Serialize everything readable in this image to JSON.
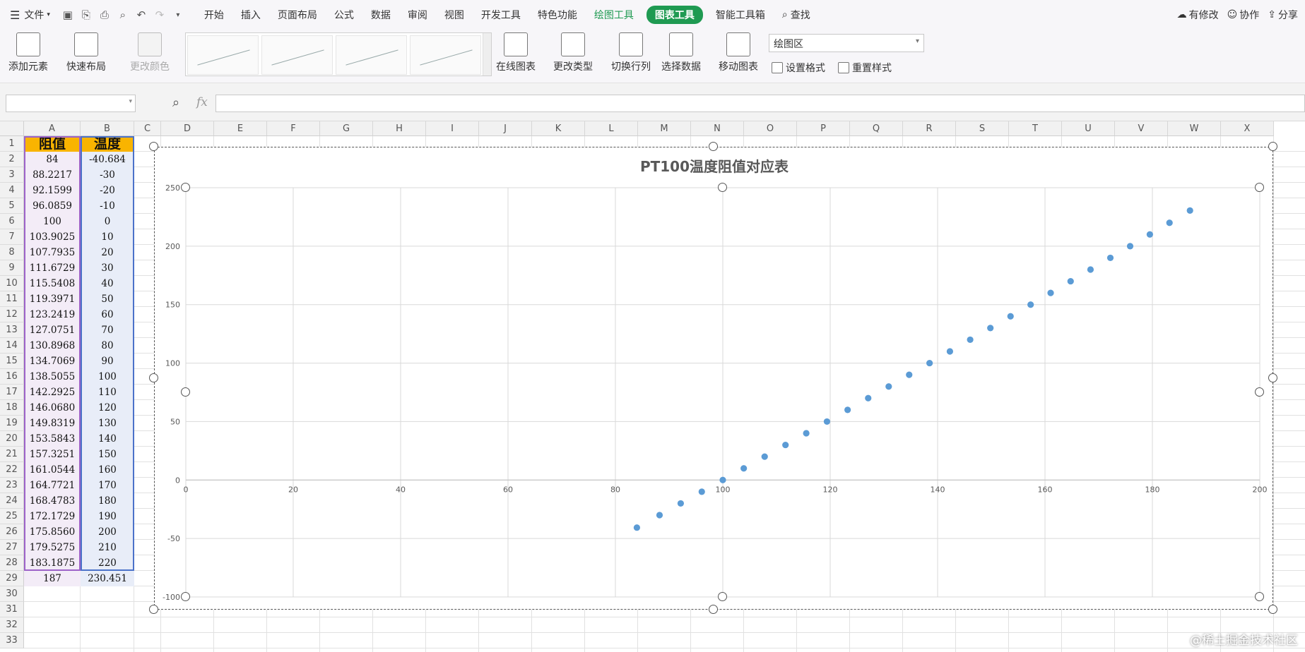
{
  "menubar": {
    "file_label": "文件",
    "tabs": [
      "开始",
      "插入",
      "页面布局",
      "公式",
      "数据",
      "审阅",
      "视图",
      "开发工具",
      "特色功能"
    ],
    "drawing_tools": "绘图工具",
    "chart_tools": "图表工具",
    "smart_toolbox": "智能工具箱",
    "search_label": "查找",
    "has_changes": "有修改",
    "collaborate": "协作",
    "share": "分享"
  },
  "ribbon": {
    "add_element": "添加元素",
    "quick_layout": "快速布局",
    "change_color": "更改颜色",
    "online_chart": "在线图表",
    "change_type": "更改类型",
    "switch_rowcol": "切换行列",
    "select_data": "选择数据",
    "move_chart": "移动图表",
    "element_select": "绘图区",
    "format_selection": "设置格式",
    "reset_style": "重置样式"
  },
  "formula_bar": {
    "fx_label": "fx",
    "name_box": "",
    "value": ""
  },
  "sheet": {
    "columns": [
      "A",
      "B",
      "C",
      "D",
      "E",
      "F",
      "G",
      "H",
      "I",
      "J",
      "K",
      "L",
      "M",
      "N",
      "O",
      "P",
      "Q",
      "R",
      "S",
      "T",
      "U",
      "V",
      "W",
      "X"
    ],
    "rows": [
      "1",
      "2",
      "3",
      "4",
      "5",
      "6",
      "7",
      "8",
      "9",
      "10",
      "11",
      "12",
      "13",
      "14",
      "15",
      "16",
      "17",
      "18",
      "19",
      "20",
      "21",
      "22",
      "23",
      "24",
      "25",
      "26",
      "27",
      "28",
      "29",
      "30",
      "31",
      "32",
      "33"
    ],
    "header_a": "阻值",
    "header_b": "温度",
    "col_a": [
      "84",
      "88.2217",
      "92.1599",
      "96.0859",
      "100",
      "103.9025",
      "107.7935",
      "111.6729",
      "115.5408",
      "119.3971",
      "123.2419",
      "127.0751",
      "130.8968",
      "134.7069",
      "138.5055",
      "142.2925",
      "146.0680",
      "149.8319",
      "153.5843",
      "157.3251",
      "161.0544",
      "164.7721",
      "168.4783",
      "172.1729",
      "175.8560",
      "179.5275",
      "183.1875",
      "187"
    ],
    "col_b": [
      "-40.684",
      "-30",
      "-20",
      "-10",
      "0",
      "10",
      "20",
      "30",
      "40",
      "50",
      "60",
      "70",
      "80",
      "90",
      "100",
      "110",
      "120",
      "130",
      "140",
      "150",
      "160",
      "170",
      "180",
      "190",
      "200",
      "210",
      "220",
      "230.451"
    ]
  },
  "chart_data": {
    "type": "scatter",
    "title": "PT100温度阻值对应表",
    "xlabel": "",
    "ylabel": "",
    "xlim": [
      0,
      200
    ],
    "ylim": [
      -100,
      250
    ],
    "x_ticks": [
      "0",
      "20",
      "40",
      "60",
      "80",
      "100",
      "120",
      "140",
      "160",
      "180",
      "200"
    ],
    "y_ticks": [
      "250",
      "200",
      "150",
      "100",
      "50",
      "0",
      "-50",
      "-100"
    ],
    "grid": true,
    "marker_color": "#5b9bd5",
    "x": [
      84,
      88.2217,
      92.1599,
      96.0859,
      100,
      103.9025,
      107.7935,
      111.6729,
      115.5408,
      119.3971,
      123.2419,
      127.0751,
      130.8968,
      134.7069,
      138.5055,
      142.2925,
      146.068,
      149.8319,
      153.5843,
      157.3251,
      161.0544,
      164.7721,
      168.4783,
      172.1729,
      175.856,
      179.5275,
      183.1875,
      187
    ],
    "y": [
      -40.684,
      -30,
      -20,
      -10,
      0,
      10,
      20,
      30,
      40,
      50,
      60,
      70,
      80,
      90,
      100,
      110,
      120,
      130,
      140,
      150,
      160,
      170,
      180,
      190,
      200,
      210,
      220,
      230.451
    ]
  },
  "watermark": "@稀土掘金技术社区"
}
